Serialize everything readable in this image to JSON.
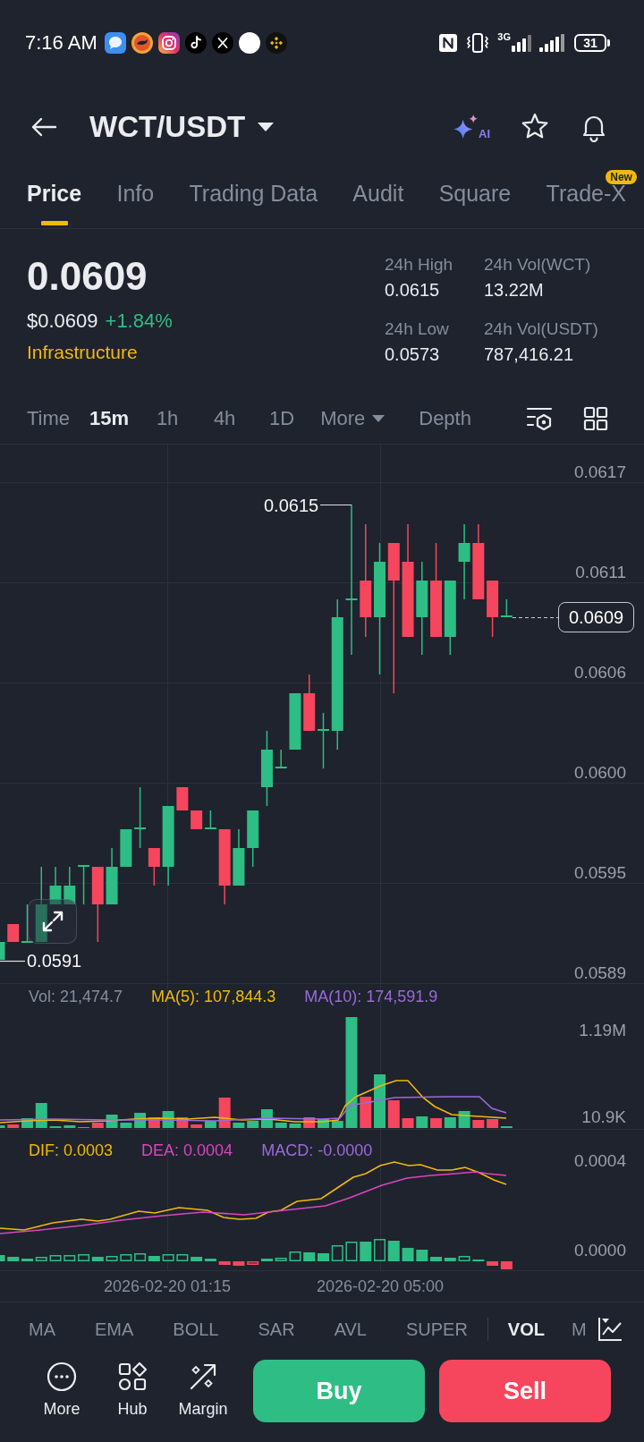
{
  "status_bar": {
    "time": "7:16 AM",
    "network": "3G",
    "battery": "31"
  },
  "header": {
    "pair": "WCT/USDT",
    "ai_label": "AI"
  },
  "tabs": [
    {
      "label": "Price",
      "selected": true
    },
    {
      "label": "Info",
      "selected": false
    },
    {
      "label": "Trading Data",
      "selected": false
    },
    {
      "label": "Audit",
      "selected": false
    },
    {
      "label": "Square",
      "selected": false
    },
    {
      "label": "Trade-X",
      "selected": false,
      "badge": "New"
    }
  ],
  "price": {
    "last": "0.0609",
    "usd": "$0.0609",
    "change": "+1.84%",
    "category": "Infrastructure"
  },
  "stats": [
    {
      "label": "24h High",
      "value": "0.0615"
    },
    {
      "label": "24h Vol(WCT)",
      "value": "13.22M"
    },
    {
      "label": "24h Low",
      "value": "0.0573"
    },
    {
      "label": "24h Vol(USDT)",
      "value": "787,416.21"
    }
  ],
  "intervals": [
    {
      "label": "Time",
      "kind": "option",
      "selected": false
    },
    {
      "label": "15m",
      "kind": "option",
      "selected": true
    },
    {
      "label": "1h",
      "kind": "option",
      "selected": false
    },
    {
      "label": "4h",
      "kind": "option",
      "selected": false
    },
    {
      "label": "1D",
      "kind": "option",
      "selected": false
    },
    {
      "label": "More",
      "kind": "menu",
      "selected": false
    },
    {
      "label": "Depth",
      "kind": "option",
      "selected": false
    }
  ],
  "chart": {
    "price_axis": [
      "0.0617",
      "0.0611",
      "0.0606",
      "0.0600",
      "0.0595",
      "0.0589"
    ],
    "high_label": "0.0615",
    "low_label": "0.0591",
    "last_price": "0.0609"
  },
  "volume": {
    "legend": [
      {
        "text": "Vol: 21,474.7",
        "color": "#848e9c"
      },
      {
        "text": "MA(5): 107,844.3",
        "color": "#f0b90b"
      },
      {
        "text": "MA(10): 174,591.9",
        "color": "#9c6ade"
      }
    ],
    "axis": [
      "1.19M",
      "10.9K"
    ]
  },
  "macd": {
    "legend": [
      {
        "text": "DIF: 0.0003",
        "color": "#f0b90b"
      },
      {
        "text": "DEA: 0.0004",
        "color": "#d946c1"
      },
      {
        "text": "MACD: -0.0000",
        "color": "#9c6ade"
      }
    ],
    "axis": [
      "0.0004",
      "0.0000"
    ]
  },
  "time_axis": [
    "2026-02-20 01:15",
    "2026-02-20 05:00"
  ],
  "main_indicators": [
    {
      "label": "MA",
      "selected": false
    },
    {
      "label": "EMA",
      "selected": false
    },
    {
      "label": "BOLL",
      "selected": false
    },
    {
      "label": "SAR",
      "selected": false
    },
    {
      "label": "AVL",
      "selected": false
    },
    {
      "label": "SUPER",
      "selected": false
    }
  ],
  "sub_indicators": [
    {
      "label": "VOL",
      "selected": true
    },
    {
      "label": "M",
      "selected": false
    }
  ],
  "toolbar": [
    {
      "label": "More"
    },
    {
      "label": "Hub"
    },
    {
      "label": "Margin"
    }
  ],
  "trade_buttons": [
    {
      "label": "Buy",
      "kind": "buy"
    },
    {
      "label": "Sell",
      "kind": "sell"
    }
  ]
}
